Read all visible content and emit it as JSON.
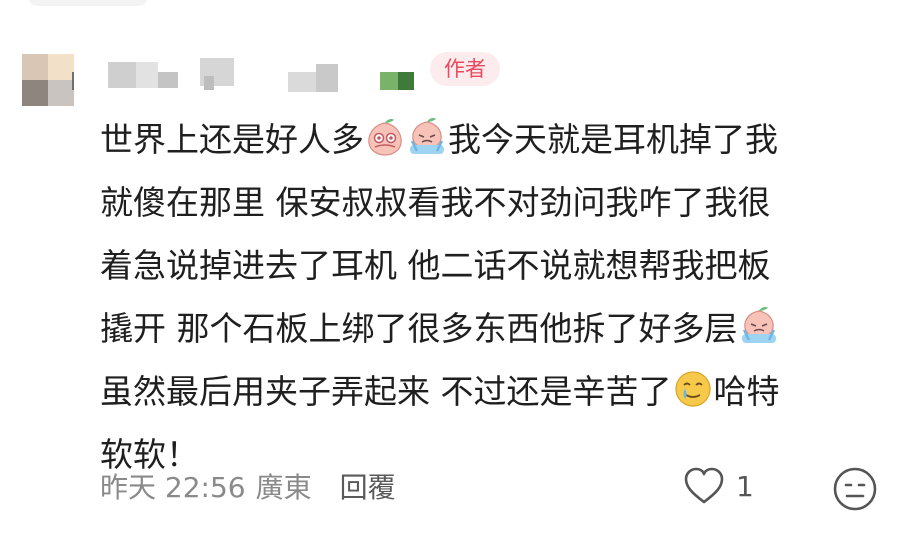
{
  "comment": {
    "author_badge": "作者",
    "body_lines": {
      "line1_a": "世界上还是好人多",
      "line1_b": "我今天就是耳机掉了我",
      "line2": "就傻在那里 保安叔叔看我不对劲问我咋了我很",
      "line3": "着急说掉进去了耳机 他二话不说就想帮我把板",
      "line4": "撬开 那个石板上绑了很多东西他拆了好多层",
      "line5_a": "虽然最后用夹子弄起来 不过还是辛苦了",
      "line5_b": "哈特",
      "line6": "软软！"
    },
    "emoji": [
      "peach-emoji-blush",
      "peach-emoji-cry",
      "peach-emoji-cry",
      "tear-smile-emoji"
    ],
    "time": "昨天 22:56",
    "location": "廣東",
    "reply_label": "回覆",
    "like_count": "1"
  },
  "colors": {
    "badge_text": "#ea4a5e",
    "badge_bg": "#fdeced",
    "meta_text": "#8a8a8a"
  },
  "icons": [
    "heart-icon",
    "emoji-reaction-icon"
  ]
}
